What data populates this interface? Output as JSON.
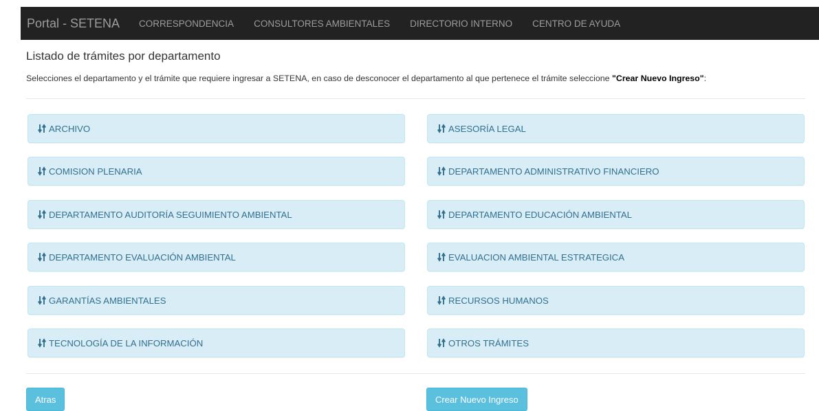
{
  "navbar": {
    "brand": "Portal - SETENA",
    "links": [
      "CORRESPONDENCIA",
      "CONSULTORES AMBIENTALES",
      "DIRECTORIO INTERNO",
      "CENTRO DE AYUDA"
    ]
  },
  "page": {
    "title": "Listado de trámites por departamento",
    "instructions_prefix": "Selecciones el departamento y el trámite que requiere ingresar a SETENA, en caso de desconocer el departamento al que pertenece el trámite seleccione ",
    "instructions_bold": "\"Crear Nuevo Ingreso\"",
    "instructions_suffix": ":"
  },
  "departments": [
    "ARCHIVO",
    "ASESORÍA LEGAL",
    "COMISION PLENARIA",
    "DEPARTAMENTO ADMINISTRATIVO FINANCIERO",
    "DEPARTAMENTO AUDITORÍA SEGUIMIENTO AMBIENTAL",
    "DEPARTAMENTO EDUCACIÓN AMBIENTAL",
    "DEPARTAMENTO EVALUACIÓN AMBIENTAL",
    "EVALUACION AMBIENTAL ESTRATEGICA",
    "GARANTÍAS AMBIENTALES",
    "RECURSOS HUMANOS",
    "TECNOLOGÍA DE LA INFORMACIÓN",
    "OTROS TRÁMITES"
  ],
  "department_icon": "sort-arrows-icon",
  "buttons": {
    "back": "Atras",
    "new_entry": "Crear Nuevo Ingreso"
  },
  "colors": {
    "navbar": "#222222",
    "nav_text": "#9d9d9d",
    "panel_bg": "#d9edf7",
    "panel_text": "#31708f",
    "button": "#5bc0de"
  }
}
